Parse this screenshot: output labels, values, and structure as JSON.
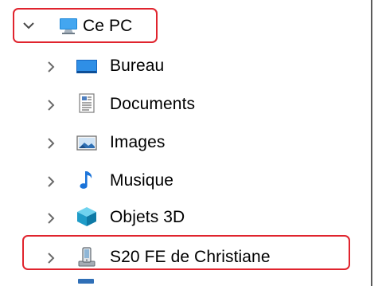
{
  "tree": {
    "root": {
      "label": "Ce PC",
      "expanded": true,
      "icon": "pc-icon"
    },
    "items": [
      {
        "label": "Bureau",
        "icon": "desktop-folder-icon",
        "expanded": false
      },
      {
        "label": "Documents",
        "icon": "documents-folder-icon",
        "expanded": false
      },
      {
        "label": "Images",
        "icon": "images-folder-icon",
        "expanded": false
      },
      {
        "label": "Musique",
        "icon": "music-folder-icon",
        "expanded": false
      },
      {
        "label": "Objets 3D",
        "icon": "3d-objects-folder-icon",
        "expanded": false
      },
      {
        "label": "S20 FE de Christiane",
        "icon": "phone-device-icon",
        "expanded": false
      }
    ]
  },
  "colors": {
    "highlight_border": "#e0242e",
    "chevron": "#5a5a5a",
    "text": "#000000"
  }
}
